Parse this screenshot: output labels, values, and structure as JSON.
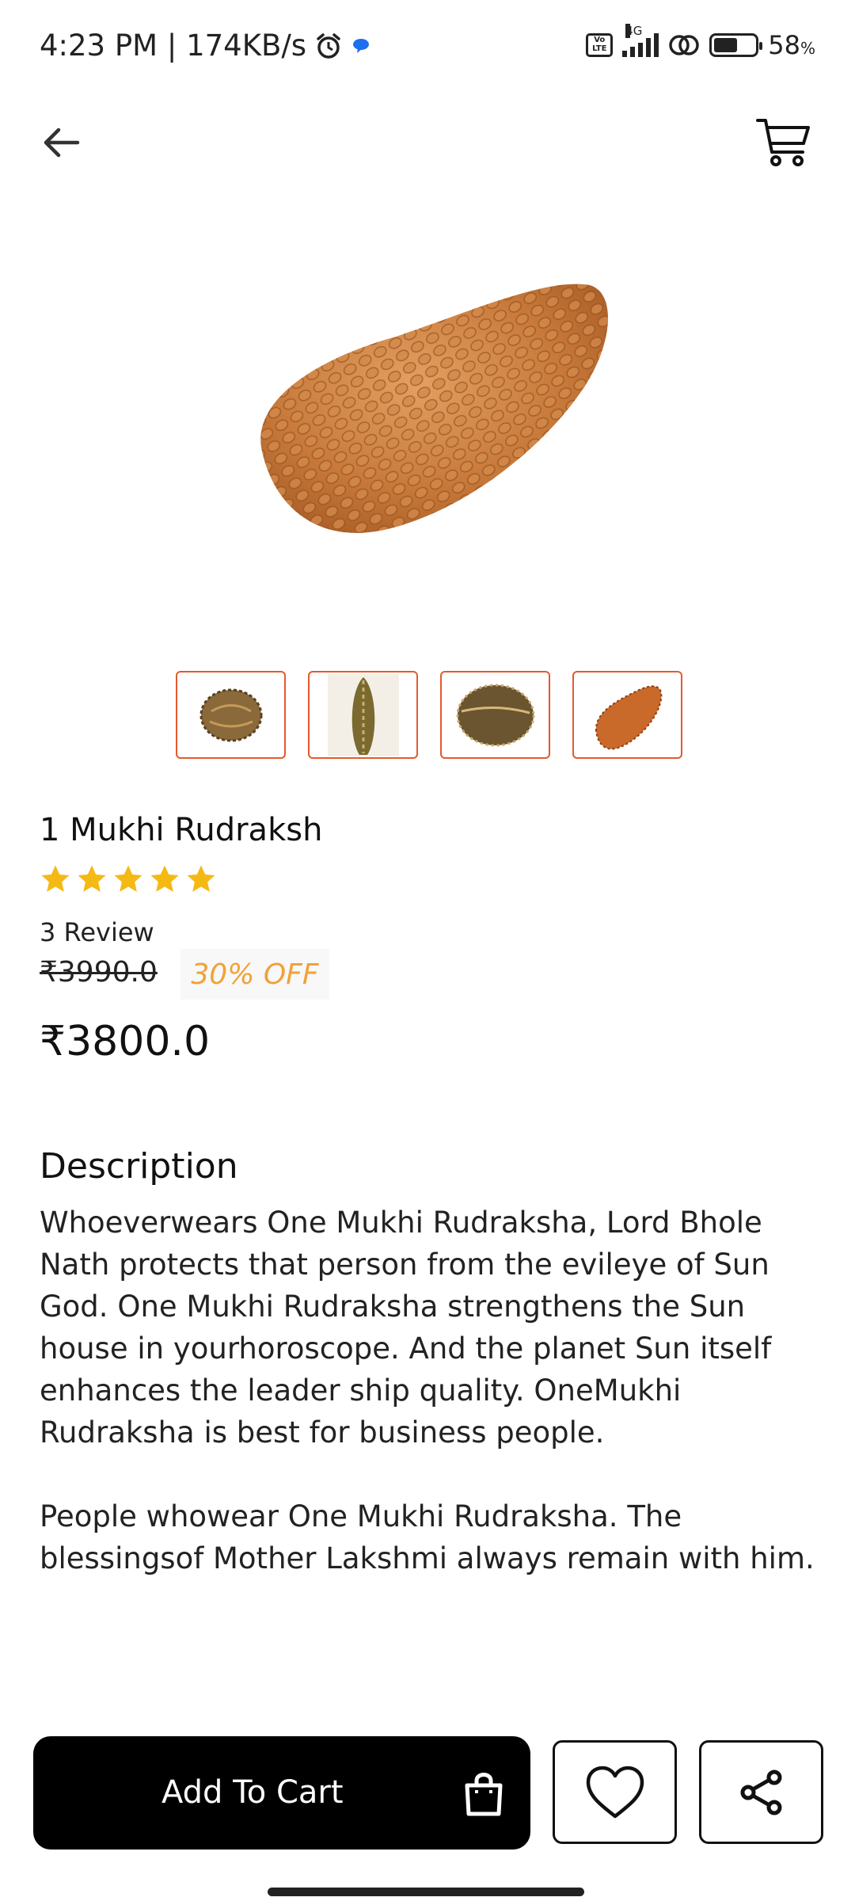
{
  "status_bar": {
    "time_speed": "4:23 PM | 174KB/s",
    "network": "4G",
    "volte": "Vo LTE",
    "battery": "58",
    "battery_unit": "%"
  },
  "header": {
    "back_icon": "arrow-left-icon",
    "cart_icon": "shopping-cart-icon"
  },
  "product": {
    "name": "1 Mukhi Rudraksh",
    "rating": 5,
    "rating_max": 5,
    "reviews": "3 Review",
    "original_price": "₹3990.0",
    "discount": "30% OFF",
    "price": "₹3800.0",
    "thumbnails_count": 4
  },
  "description": {
    "heading": "Description",
    "paragraph1": "Whoeverwears One Mukhi Rudraksha, Lord Bhole Nath protects that person from the evileye of Sun God. One Mukhi Rudraksha strengthens the Sun house in yourhoroscope. And the planet Sun itself enhances the leader ship quality. OneMukhi Rudraksha is best for business people.",
    "paragraph2": "People whowear One Mukhi Rudraksha.  The blessingsof Mother Lakshmi always remain with him."
  },
  "actions": {
    "add_to_cart": "Add To Cart",
    "bag_icon": "shopping-bag-icon",
    "wishlist_icon": "heart-icon",
    "share_icon": "share-icon"
  },
  "colors": {
    "accent": "#e45a2c",
    "discount": "#f2a138",
    "star": "#f5b914",
    "button": "#000000"
  }
}
